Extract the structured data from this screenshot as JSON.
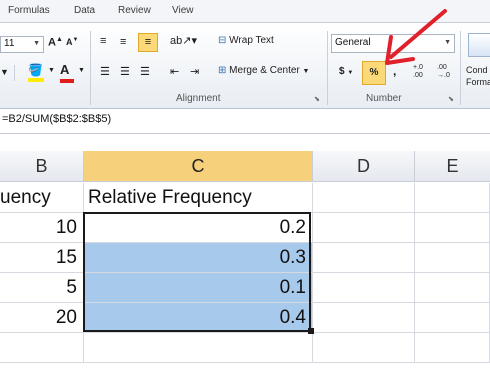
{
  "ribbon_tabs": [
    "Formulas",
    "Data",
    "Review",
    "View"
  ],
  "font_group": {
    "font_size": "11",
    "grow_font": "A",
    "shrink_font": "A",
    "font_color_letter": "A"
  },
  "alignment_group": {
    "wrap_text": "Wrap Text",
    "merge_center": "Merge & Center",
    "label": "Alignment"
  },
  "number_group": {
    "format": "General",
    "currency": "$",
    "percent": "%",
    "comma": ",",
    "increase_decimal": "+.0 .00",
    "decrease_decimal": ".00 →.0",
    "label": "Number"
  },
  "styles_group": {
    "conditional_formatting_line1": "Cond",
    "conditional_formatting_line2": "Forma"
  },
  "formula_bar": {
    "formula": "=B2/SUM($B$2:$B$5)"
  },
  "columns": [
    "B",
    "C",
    "D",
    "E"
  ],
  "rows": [
    {
      "b": "uency",
      "c": "Relative Frequency"
    },
    {
      "b": "10",
      "c": "0.2"
    },
    {
      "b": "15",
      "c": "0.3"
    },
    {
      "b": "5",
      "c": "0.1"
    },
    {
      "b": "20",
      "c": "0.4"
    }
  ],
  "colors": {
    "selection": "#a7c9ec",
    "selected_header": "#f6d07a",
    "annotation_arrow": "#e0202a"
  }
}
